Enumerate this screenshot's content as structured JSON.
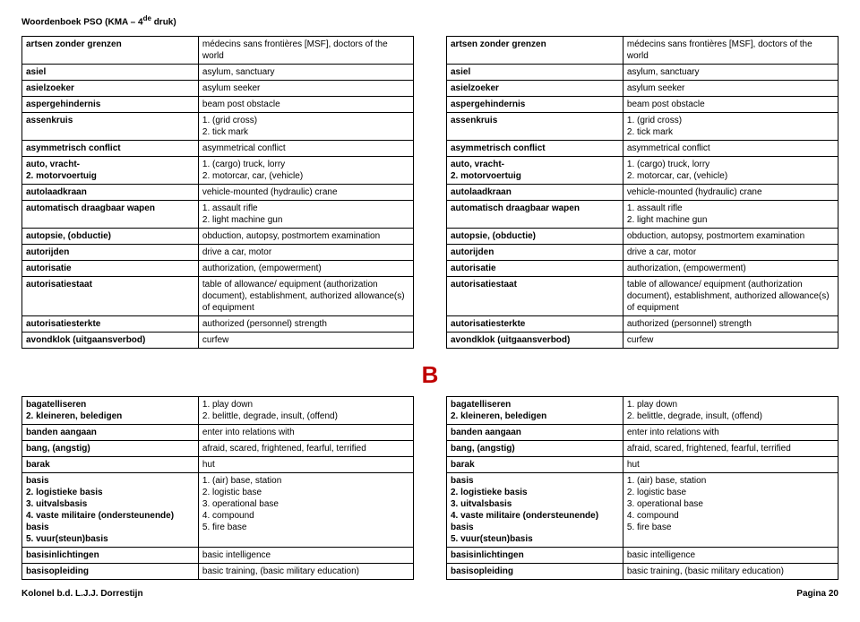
{
  "header": {
    "title_a": "Woordenboek PSO (KMA – 4",
    "title_sup": "de",
    "title_b": " druk)"
  },
  "section_letter": "B",
  "footer": {
    "left": "Kolonel b.d. L.J.J. Dorrestijn",
    "right": "Pagina 20"
  },
  "rowsA": [
    {
      "t": "artsen zonder grenzen",
      "d": "médecins sans frontières [MSF], doctors of the world"
    },
    {
      "t": "asiel",
      "d": "asylum, sanctuary"
    },
    {
      "t": "asielzoeker",
      "d": "asylum seeker"
    },
    {
      "t": "aspergehindernis",
      "d": "beam post obstacle"
    },
    {
      "t": "assenkruis",
      "d": "1. (grid cross)\n2. tick mark"
    },
    {
      "t": "asymmetrisch conflict",
      "d": "asymmetrical conflict"
    },
    {
      "t": "auto, vracht-\n2. motorvoertuig",
      "d": "1. (cargo) truck, lorry\n2. motorcar, car, (vehicle)"
    },
    {
      "t": "autolaadkraan",
      "d": "vehicle-mounted (hydraulic) crane"
    },
    {
      "t": "automatisch draagbaar wapen",
      "d": "1. assault rifle\n2. light machine gun"
    },
    {
      "t": "autopsie, (obductie)",
      "d": "obduction, autopsy, postmortem examination"
    },
    {
      "t": "autorijden",
      "d": "drive a car, motor"
    },
    {
      "t": "autorisatie",
      "d": "authorization, (empowerment)"
    },
    {
      "t": "autorisatiestaat",
      "d": "table of allowance/ equipment (authorization document), establishment, authorized allowance(s) of equipment"
    },
    {
      "t": "autorisatiesterkte",
      "d": "authorized (personnel) strength"
    },
    {
      "t": "avondklok (uitgaansverbod)",
      "d": "curfew"
    }
  ],
  "rowsB": [
    {
      "t": "bagatelliseren\n2. kleineren, beledigen",
      "d": "1. play down\n2. belittle, degrade, insult, (offend)"
    },
    {
      "t": "banden aangaan",
      "d": "enter into relations with"
    },
    {
      "t": "bang, (angstig)",
      "d": "afraid, scared, frightened, fearful, terrified"
    },
    {
      "t": "barak",
      "d": "hut"
    },
    {
      "t": "basis\n2. logistieke basis\n3. uitvalsbasis\n4. vaste militaire (ondersteunende) basis\n5. vuur(steun)basis",
      "d": "1. (air) base, station\n2. logistic base\n3. operational base\n4. compound\n5. fire base"
    },
    {
      "t": "basisinlichtingen",
      "d": "basic intelligence"
    },
    {
      "t": "basisopleiding",
      "d": "basic training, (basic military education)"
    }
  ]
}
